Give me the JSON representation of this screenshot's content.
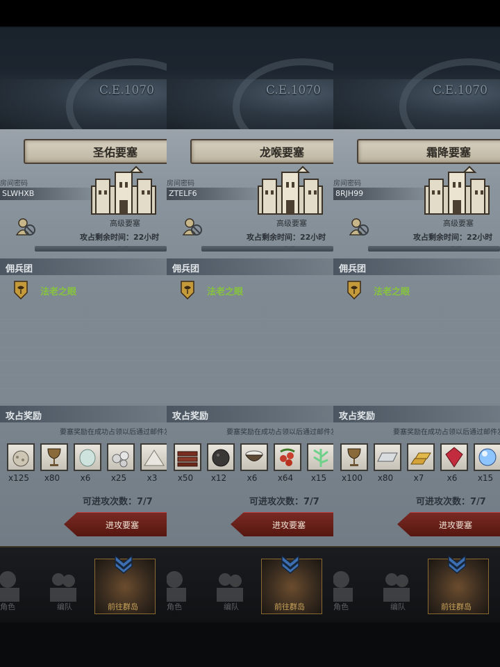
{
  "era_label": "C.E.1070",
  "labels": {
    "room_code_label": "房间密码",
    "tier": "高级要塞",
    "time_left": "攻占剩余时间：22小时",
    "progress": "0/0",
    "mercenary_section": "佣兵团",
    "reward_section": "攻占奖励",
    "reward_note": "要塞奖励在成功占领以后通过邮件发送",
    "attempts": "可进攻次数：7/7",
    "attack_button": "进攻要塞"
  },
  "progress_fraction": 0,
  "nav": {
    "left_label": "角色",
    "mid_label": "编队",
    "active_label": "前往群岛"
  },
  "colors": {
    "mercenary_name": "#86c43e",
    "attack_button": "#6e231c",
    "progress": "#c9a645"
  },
  "forts": [
    {
      "name": "圣佑要塞",
      "room_code": "SLWHXB",
      "mercenary": "法老之眼",
      "rewards": [
        {
          "icon": "ore-icon",
          "qty": "x125"
        },
        {
          "icon": "goblet-icon",
          "qty": "x80"
        },
        {
          "icon": "stone-icon",
          "qty": "x6"
        },
        {
          "icon": "pearls-icon",
          "qty": "x25"
        },
        {
          "icon": "salt-pile-icon",
          "qty": "x3"
        }
      ]
    },
    {
      "name": "龙喉要塞",
      "room_code": "ZTELF6",
      "mercenary": "法老之眼",
      "rewards": [
        {
          "icon": "wood-planks-icon",
          "qty": "x50"
        },
        {
          "icon": "coal-icon",
          "qty": "x12"
        },
        {
          "icon": "salt-bowl-icon",
          "qty": "x6"
        },
        {
          "icon": "berries-icon",
          "qty": "x64"
        },
        {
          "icon": "herb-icon",
          "qty": "x15"
        }
      ]
    },
    {
      "name": "霜降要塞",
      "room_code": "8RJH99",
      "mercenary": "法老之眼",
      "rewards": [
        {
          "icon": "goblet-icon",
          "qty": "x100"
        },
        {
          "icon": "silver-ingot-icon",
          "qty": "x80"
        },
        {
          "icon": "gold-bars-icon",
          "qty": "x7"
        },
        {
          "icon": "ruby-icon",
          "qty": "x6"
        },
        {
          "icon": "crystal-orb-icon",
          "qty": "x15"
        }
      ]
    }
  ]
}
